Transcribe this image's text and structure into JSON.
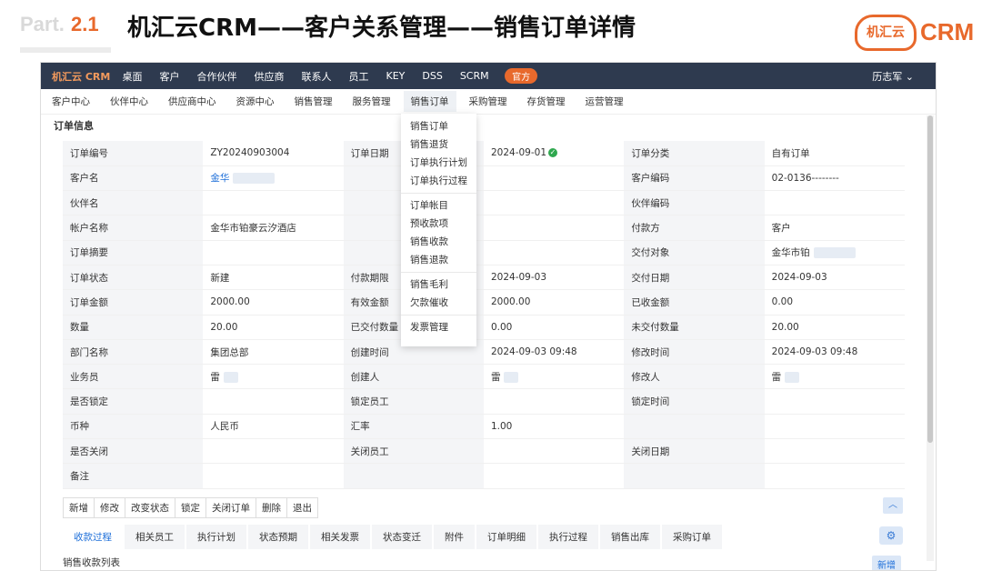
{
  "slide": {
    "part": "Part.",
    "num": "2.1",
    "title": "机汇云CRM——客户关系管理——销售订单详情",
    "brand_cloud": "机汇云",
    "brand_crm": "CRM"
  },
  "topnav": {
    "logo": "机汇云 CRM",
    "items": [
      "桌面",
      "客户",
      "合作伙伴",
      "供应商",
      "联系人",
      "员工",
      "KEY",
      "DSS",
      "SCRM"
    ],
    "badge": "官方",
    "user": "历志军 ⌄"
  },
  "subnav": [
    "客户中心",
    "伙伴中心",
    "供应商中心",
    "资源中心",
    "销售管理",
    "服务管理",
    "销售订单",
    "采购管理",
    "存货管理",
    "运营管理"
  ],
  "section": "订单信息",
  "menu": {
    "g1": [
      "销售订单",
      "销售退货",
      "订单执行计划",
      "订单执行过程"
    ],
    "g2": [
      "订单帐目",
      "预收款项",
      "销售收款",
      "销售退款"
    ],
    "g3": [
      "销售毛利",
      "欠款催收"
    ],
    "g4": [
      "发票管理"
    ]
  },
  "rows": [
    [
      "订单编号",
      "ZY20240903004",
      "订单日期",
      "2024-09-01",
      "订单分类",
      "自有订单"
    ],
    [
      "客户名",
      "金华",
      "",
      "",
      "客户编码",
      "02-0136--------"
    ],
    [
      "伙伴名",
      "",
      "",
      "",
      "伙伴编码",
      ""
    ],
    [
      "帐户名称",
      "金华市铂豪云汐酒店",
      "",
      "",
      "付款方",
      "客户"
    ],
    [
      "订单摘要",
      "",
      "",
      "",
      "交付对象",
      "金华市铂"
    ],
    [
      "订单状态",
      "新建",
      "付款期限",
      "2024-09-03",
      "交付日期",
      "2024-09-03"
    ],
    [
      "订单金额",
      "2000.00",
      "有效金额",
      "2000.00",
      "已收金额",
      "0.00"
    ],
    [
      "数量",
      "20.00",
      "已交付数量",
      "0.00",
      "未交付数量",
      "20.00"
    ],
    [
      "部门名称",
      "集团总部",
      "创建时间",
      "2024-09-03 09:48",
      "修改时间",
      "2024-09-03 09:48"
    ],
    [
      "业务员",
      "雷",
      "创建人",
      "雷",
      "修改人",
      "雷"
    ],
    [
      "是否锁定",
      "",
      "锁定员工",
      "",
      "锁定时间",
      ""
    ],
    [
      "币种",
      "人民币",
      "汇率",
      "1.00",
      "",
      ""
    ],
    [
      "是否关闭",
      "",
      "关闭员工",
      "",
      "关闭日期",
      ""
    ],
    [
      "备注",
      "",
      "",
      "",
      "",
      ""
    ]
  ],
  "actions": [
    "新增",
    "修改",
    "改变状态",
    "锁定",
    "关闭订单",
    "删除",
    "退出"
  ],
  "tabs": [
    "收款过程",
    "相关员工",
    "执行计划",
    "状态预期",
    "相关发票",
    "状态变迁",
    "附件",
    "订单明细",
    "执行过程",
    "销售出库",
    "采购订单"
  ],
  "list_title": "销售收款列表",
  "add_label": "新增"
}
